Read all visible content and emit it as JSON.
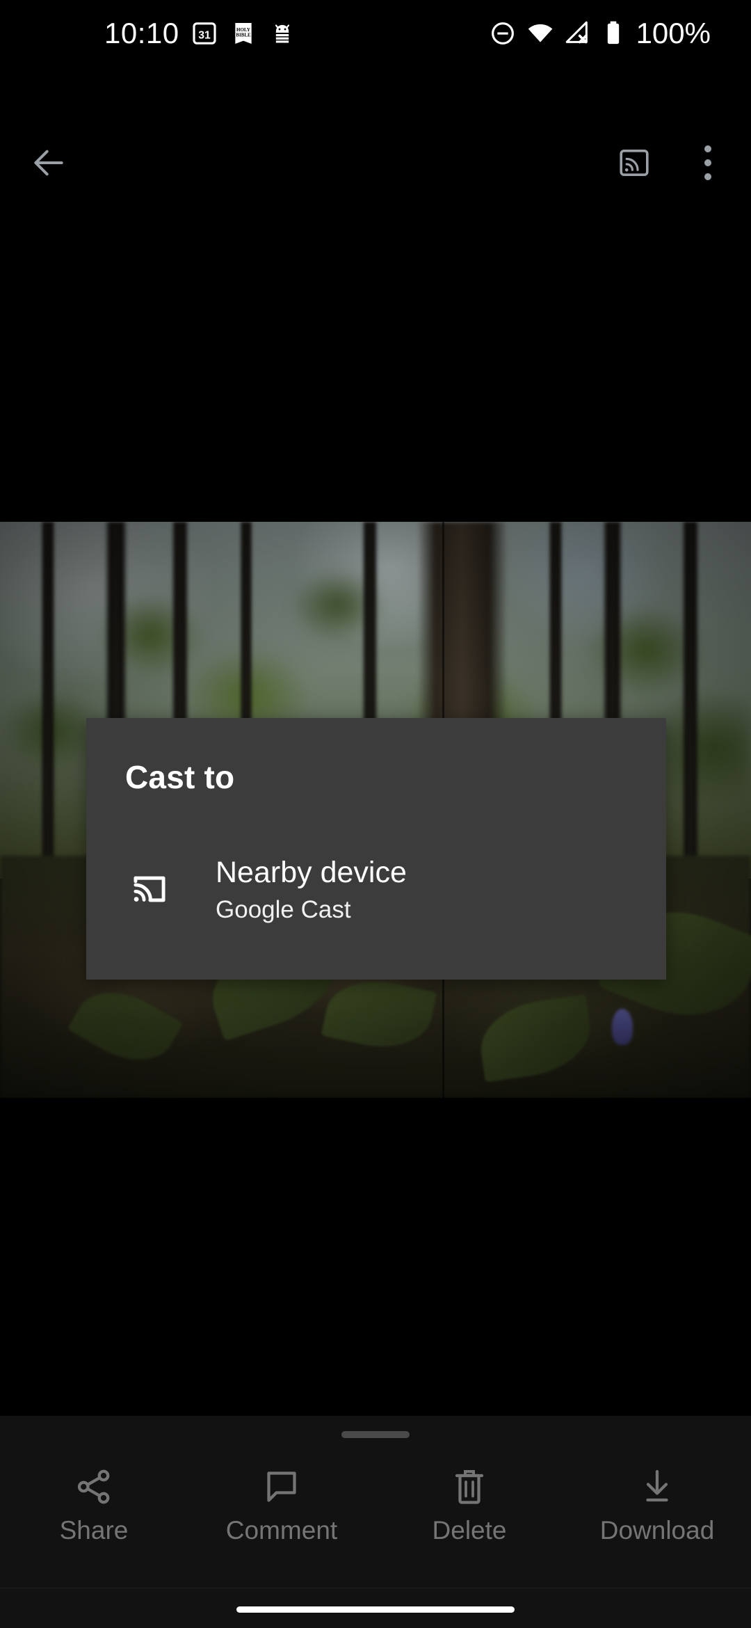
{
  "status_bar": {
    "time": "10:10",
    "battery_percent": "100%",
    "notification_icons": [
      {
        "name": "calendar-icon",
        "label": "31"
      },
      {
        "name": "bible-app-icon",
        "label": "HOLY BIBLE"
      },
      {
        "name": "android-system-icon",
        "label": "Android"
      }
    ],
    "system_icons": [
      {
        "name": "do-not-disturb-icon",
        "label": "Do not disturb"
      },
      {
        "name": "wifi-icon",
        "label": "Wi-Fi connected"
      },
      {
        "name": "cellular-off-icon",
        "label": "No mobile signal"
      },
      {
        "name": "battery-icon",
        "label": "Battery full"
      }
    ]
  },
  "toolbar": {
    "back_label": "Back",
    "cast_label": "Cast",
    "overflow_label": "More options"
  },
  "photo": {
    "description": "Forest scene with tall dark tree trunks, green canopy and leafy ground cover"
  },
  "cast_dialog": {
    "title": "Cast to",
    "devices": [
      {
        "name": "Nearby device",
        "subtitle": "Google Cast",
        "icon": "cast-icon"
      }
    ],
    "background_color": "#3c3c3c"
  },
  "bottom_sheet": {
    "actions": [
      {
        "label": "Share",
        "icon": "share-icon"
      },
      {
        "label": "Comment",
        "icon": "comment-icon"
      },
      {
        "label": "Delete",
        "icon": "trash-icon"
      },
      {
        "label": "Download",
        "icon": "download-icon"
      }
    ]
  }
}
